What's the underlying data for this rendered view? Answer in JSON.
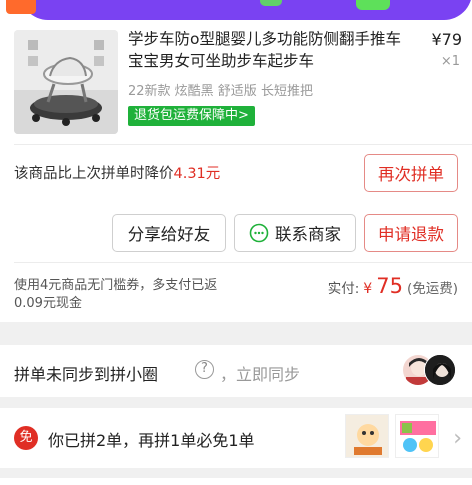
{
  "product": {
    "title": "学步车防o型腿婴儿多功能防侧翻手推车宝宝男女可坐助步车起步车",
    "price": "¥79",
    "quantity": "×1",
    "specs": "22新款 炫酷黑 舒适版 长短推把",
    "guarantee": "退货包运费保障中>"
  },
  "price_drop": {
    "text": "该商品比上次拼单时降价",
    "amount": "4.31元"
  },
  "buttons": {
    "reorder": "再次拼单",
    "share": "分享给好友",
    "contact": "联系商家",
    "refund": "申请退款"
  },
  "coupon_text": "使用4元商品无门槛券，多支付已返0.09元现金",
  "payment": {
    "label": "实付:",
    "currency": "¥",
    "amount": "75",
    "shipping": "(免运费)"
  },
  "sync": {
    "label": "拼单未同步到拼小圈",
    "help": "?",
    "action": "，立即同步"
  },
  "promo": {
    "badge": "免",
    "text": "你已拼2单，再拼1单必免1单",
    "chevron": "›"
  },
  "icons": [
    "chat-icon",
    "help-icon",
    "chevron-right-icon"
  ],
  "colors": {
    "accent_red": "#e02e24",
    "guarantee_green": "#1fb13a",
    "banner_purple": "#7a42f2"
  }
}
